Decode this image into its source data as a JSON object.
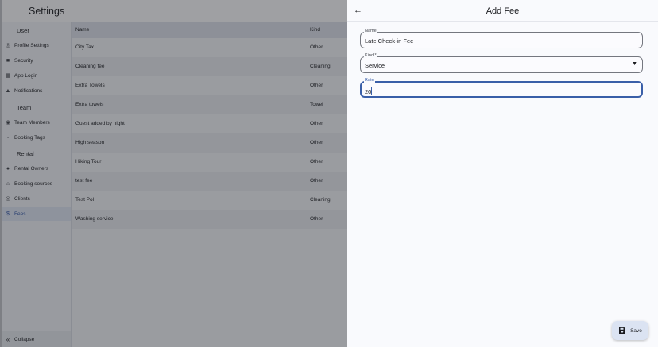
{
  "app": {
    "title": "Settings"
  },
  "sidebar": {
    "sections": [
      {
        "label": "User",
        "items": [
          {
            "label": "Profile Settings",
            "icon": "account-circle-icon"
          },
          {
            "label": "Security",
            "icon": "lock-icon"
          },
          {
            "label": "App Login",
            "icon": "grid-icon"
          },
          {
            "label": "Notifications",
            "icon": "bell-icon"
          }
        ]
      },
      {
        "label": "Team",
        "items": [
          {
            "label": "Team Members",
            "icon": "globe-icon"
          },
          {
            "label": "Booking Tags",
            "icon": "bookmark-icon"
          }
        ]
      },
      {
        "label": "Rental",
        "items": [
          {
            "label": "Rental Owners",
            "icon": "people-icon"
          },
          {
            "label": "Booking sources",
            "icon": "home-icon"
          },
          {
            "label": "Clients",
            "icon": "client-icon"
          },
          {
            "label": "Fees",
            "icon": "dollar-icon",
            "active": true
          }
        ]
      }
    ],
    "collapse_label": "Collapse"
  },
  "table": {
    "columns": [
      "Name",
      "Kind"
    ],
    "rows": [
      {
        "name": "City Tax",
        "kind": "Other"
      },
      {
        "name": "Cleaning fee",
        "kind": "Cleaning"
      },
      {
        "name": "Extra Towels",
        "kind": "Other"
      },
      {
        "name": "Extra towels",
        "kind": "Towel"
      },
      {
        "name": "Guest added by night",
        "kind": "Other"
      },
      {
        "name": "High season",
        "kind": "Other"
      },
      {
        "name": "Hiking Tour",
        "kind": "Other"
      },
      {
        "name": "test fee",
        "kind": "Other"
      },
      {
        "name": "Test Pol",
        "kind": "Cleaning"
      },
      {
        "name": "Washing service",
        "kind": "Other"
      }
    ]
  },
  "dialog": {
    "title": "Add Fee",
    "back_icon": "arrow-left-icon",
    "fields": {
      "name": {
        "label": "Name",
        "value": "Late Check-in Fee"
      },
      "kind": {
        "label": "Kind *",
        "value": "Service"
      },
      "rate": {
        "label": "Rate",
        "value": "20"
      }
    },
    "save_label": "Save",
    "save_icon": "floppy-disk-icon"
  },
  "colors": {
    "accent": "#3a5fa8",
    "active_nav": "#2e53a6",
    "scrim": "#202126"
  }
}
